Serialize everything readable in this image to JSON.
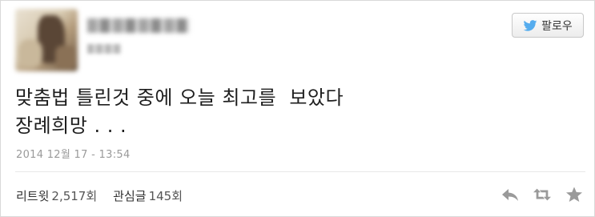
{
  "follow_button": {
    "label": "팔로우",
    "icon": "twitter-bird-icon"
  },
  "tweet": {
    "line1": "맞춤법 틀린것 중에 오늘 최고를  보았다",
    "line2": "장례희망 . . .",
    "timestamp": "2014 12월 17 - 13:54"
  },
  "stats": {
    "retweets_label": "리트윗",
    "retweets_count": "2,517회",
    "favorites_label": "관심글",
    "favorites_count": "145회"
  },
  "actions": [
    "reply-icon",
    "retweet-icon",
    "favorite-icon"
  ],
  "colors": {
    "twitter_blue": "#55acee",
    "icon_gray": "#9a9a9a"
  }
}
